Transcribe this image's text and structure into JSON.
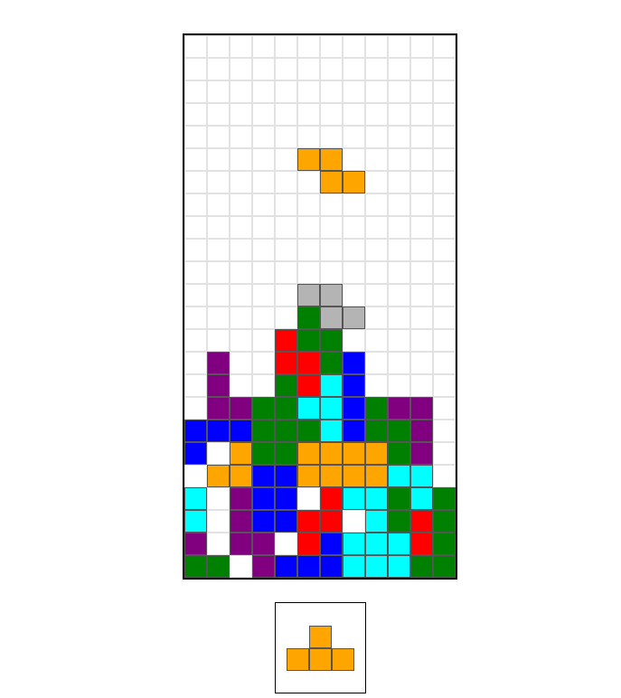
{
  "game": "Tetris",
  "palette": {
    "O": "#ffa500",
    "G": "#008000",
    "R": "#ff0000",
    "P": "#800080",
    "B": "#0000ff",
    "C": "#00ffff",
    "X": "#b4b4b4"
  },
  "board": {
    "columns": 12,
    "rows": [
      "............",
      "............",
      "............",
      "............",
      "............",
      "............",
      "............",
      "............",
      "............",
      "............",
      "............",
      "............",
      ".....G......",
      "....RGG.....",
      ".P..RRGB....",
      ".P..GRCB....",
      ".PPGGCCBGPP.",
      "BBBGGGCBGGP.",
      "B.OGGOOOOGP.",
      ".OOBBOOOOCC.",
      "C.PBB.RCCGCG",
      "C.PBBRR.CGRG",
      "P.PP.RBCCCRG",
      "GG.PBBBCCCGG"
    ]
  },
  "falling": {
    "color": "O",
    "cells": [
      [
        5,
        5
      ],
      [
        5,
        6
      ],
      [
        6,
        6
      ],
      [
        6,
        7
      ]
    ]
  },
  "ghost": {
    "color": "X",
    "cells": [
      [
        11,
        5
      ],
      [
        11,
        6
      ],
      [
        12,
        6
      ],
      [
        12,
        7
      ]
    ]
  },
  "next": {
    "color": "O",
    "rows": [
      ".O.",
      "OOO"
    ]
  }
}
